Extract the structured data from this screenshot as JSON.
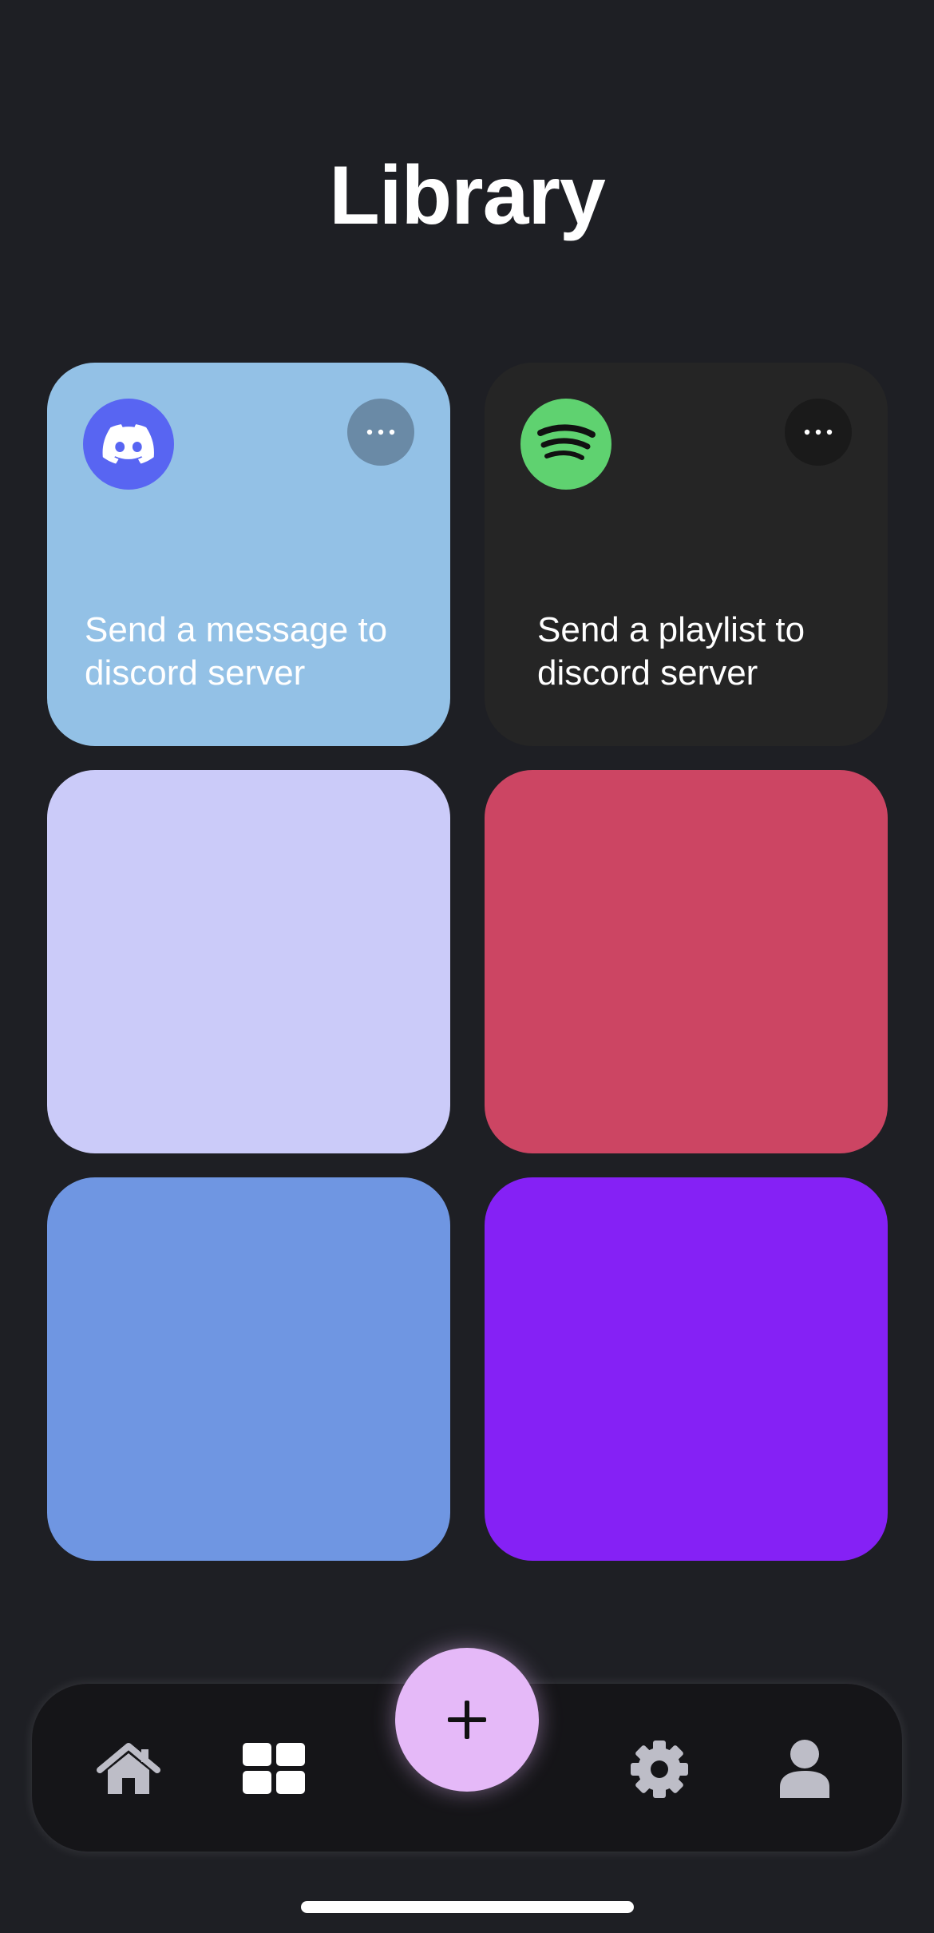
{
  "page": {
    "title": "Library"
  },
  "cards": [
    {
      "id": "discord-card",
      "color": "#93c1e6",
      "icon": "discord-icon",
      "icon_color": "#5865f2",
      "more_button_color": "#6a8aa6",
      "label": "Send a message to discord server"
    },
    {
      "id": "spotify-card",
      "color": "#252525",
      "icon": "spotify-icon",
      "icon_color": "#5fd270",
      "more_button_color": "#1a1a1a",
      "label": "Send a playlist to discord server"
    },
    {
      "id": "lavender-card",
      "color": "#cbcbf9"
    },
    {
      "id": "crimson-card",
      "color": "#cc4563"
    },
    {
      "id": "blue-card",
      "color": "#6f96e2"
    },
    {
      "id": "purple-card",
      "color": "#8521f5"
    }
  ],
  "nav": {
    "items": [
      {
        "name": "home-icon"
      },
      {
        "name": "grid-icon"
      },
      {
        "name": "settings-gear-icon"
      },
      {
        "name": "profile-icon"
      }
    ],
    "fab": {
      "icon": "plus-icon",
      "color": "#e5b9f8"
    }
  }
}
